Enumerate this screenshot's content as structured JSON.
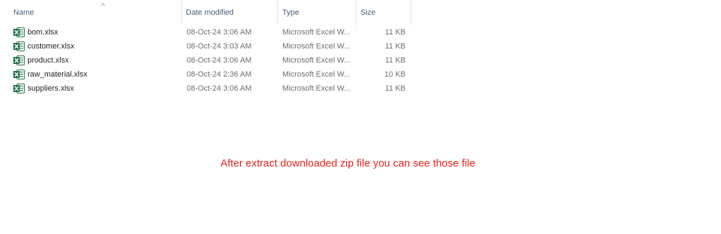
{
  "columns": {
    "name": "Name",
    "date_modified": "Date modified",
    "type": "Type",
    "size": "Size"
  },
  "sort_indicator": "^",
  "files": [
    {
      "name": "bom.xlsx",
      "date": "08-Oct-24 3:06 AM",
      "type": "Microsoft Excel W...",
      "size": "11 KB",
      "icon": "excel-file-icon"
    },
    {
      "name": "customer.xlsx",
      "date": "08-Oct-24 3:03 AM",
      "type": "Microsoft Excel W...",
      "size": "11 KB",
      "icon": "excel-file-icon"
    },
    {
      "name": "product.xlsx",
      "date": "08-Oct-24 3:06 AM",
      "type": "Microsoft Excel W...",
      "size": "11 KB",
      "icon": "excel-file-icon"
    },
    {
      "name": "raw_material.xlsx",
      "date": "08-Oct-24 2:36 AM",
      "type": "Microsoft Excel W...",
      "size": "10 KB",
      "icon": "excel-file-icon"
    },
    {
      "name": "suppliers.xlsx",
      "date": "08-Oct-24 3:06 AM",
      "type": "Microsoft Excel W...",
      "size": "11 KB",
      "icon": "excel-file-icon"
    }
  ],
  "annotation": "After extract downloaded zip file you can see those file",
  "colors": {
    "header_text": "#4c607a",
    "annotation": "#e8231c",
    "excel_green": "#1d7044"
  }
}
